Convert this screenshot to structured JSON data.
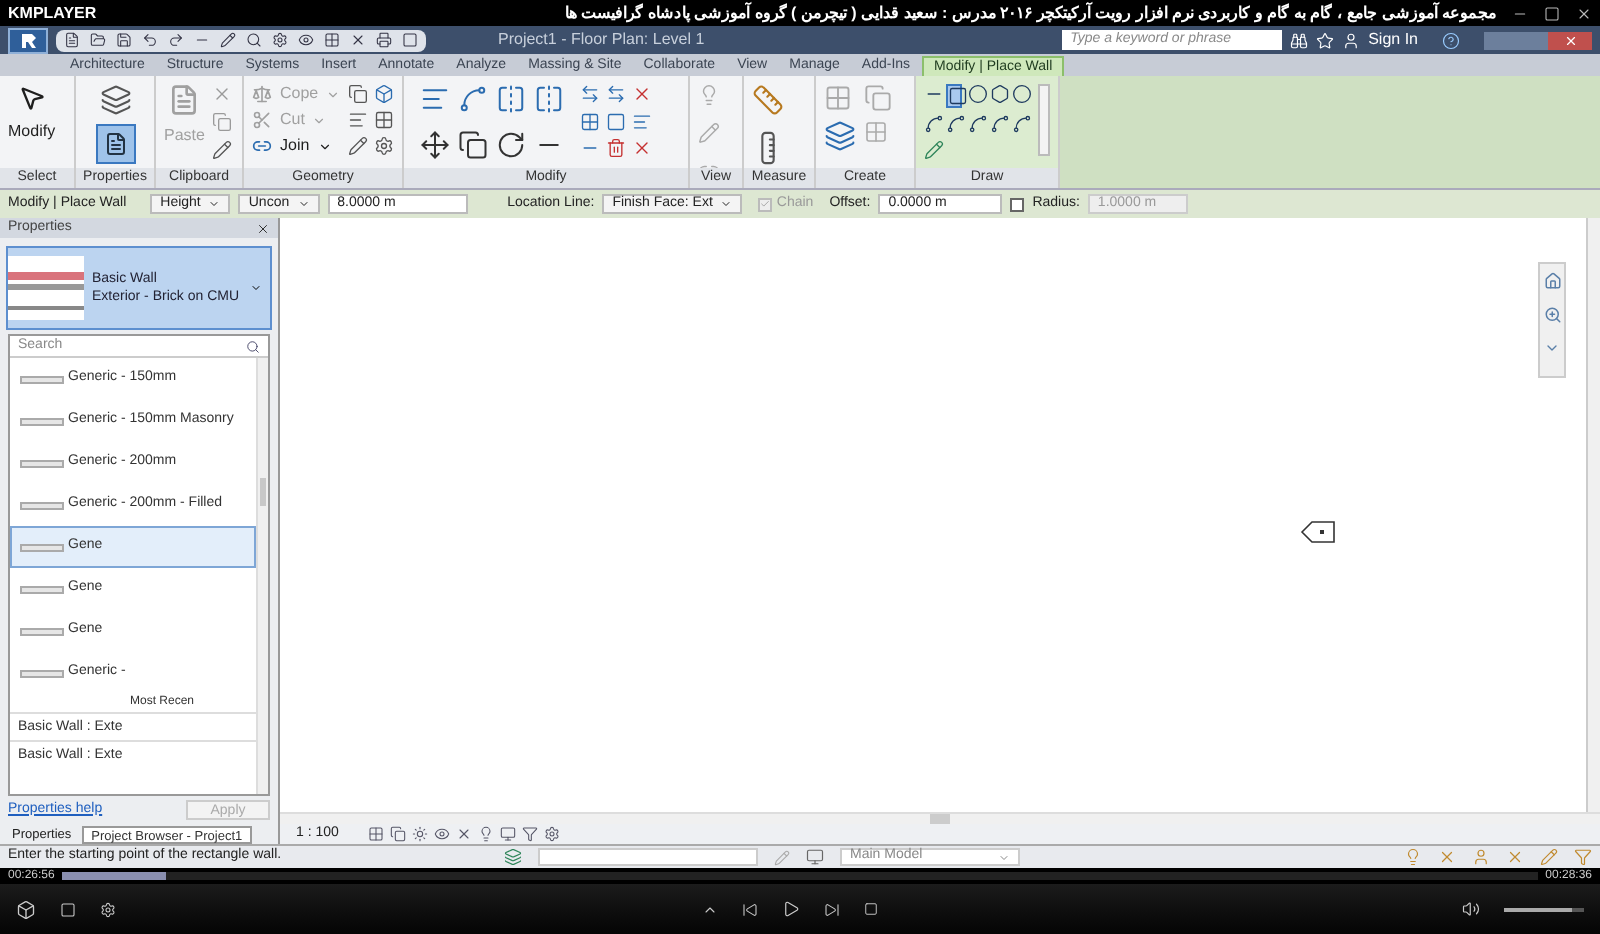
{
  "player": {
    "brand": "KMPLAYER",
    "title": "مجموعه آموزشی جامع ، گام به گام و کاربردی نرم افزار رویت آرکیتکچر ۲۰۱۶  مدرس : سعید قدایی ( تیچرمن ) گروه آموزشی پادشاه گرافیست ها"
  },
  "app": {
    "document_title": "Project1 - Floor Plan: Level 1",
    "search": {
      "placeholder": "Type a keyword or phrase"
    },
    "sign_in": "Sign In"
  },
  "ribbon_tabs": [
    {
      "label": "Architecture",
      "selected": false
    },
    {
      "label": "Structure",
      "selected": false
    },
    {
      "label": "Systems",
      "selected": false
    },
    {
      "label": "Insert",
      "selected": false
    },
    {
      "label": "Annotate",
      "selected": false
    },
    {
      "label": "Analyze",
      "selected": false
    },
    {
      "label": "Massing & Site",
      "selected": false
    },
    {
      "label": "Collaborate",
      "selected": false
    },
    {
      "label": "View",
      "selected": false
    },
    {
      "label": "Manage",
      "selected": false
    },
    {
      "label": "Add-Ins",
      "selected": false
    },
    {
      "label": "Modify | Place Wall",
      "selected": true
    }
  ],
  "ribbon_panels": [
    {
      "kind": "select",
      "title": "Select",
      "tools": [
        {
          "label": "Modify",
          "disabled": false
        }
      ]
    },
    {
      "kind": "properties",
      "title": "Properties"
    },
    {
      "kind": "clipboard",
      "title": "Clipboard",
      "tools": [
        {
          "label": "Paste",
          "disabled": true
        }
      ]
    },
    {
      "kind": "geometry",
      "title": "Geometry",
      "tools": [
        {
          "label": "Cope",
          "disabled": true
        },
        {
          "label": "Cut",
          "disabled": true
        },
        {
          "label": "Join",
          "disabled": false
        }
      ]
    },
    {
      "kind": "modify",
      "title": "Modify"
    },
    {
      "kind": "view",
      "title": "View"
    },
    {
      "kind": "measure",
      "title": "Measure"
    },
    {
      "kind": "create",
      "title": "Create"
    },
    {
      "kind": "draw",
      "title": "Draw"
    }
  ],
  "options_bar": {
    "mode": "Modify | Place Wall",
    "height_mode": "Height",
    "constraint": "Uncon",
    "height_value": "8.0000 m",
    "location_label": "Location Line:",
    "location": "Finish Face: Ext",
    "chain": {
      "label": "Chain",
      "checked": true,
      "disabled": true
    },
    "offset_label": "Offset:",
    "offset": "0.0000 m",
    "radius": {
      "label": "Radius:",
      "checked": false
    },
    "radius_value": "1.0000 m"
  },
  "properties": {
    "title": "Properties",
    "type": {
      "family": "Basic Wall",
      "name": "Exterior - Brick on CMU"
    },
    "search": {
      "placeholder": "Search"
    },
    "items": [
      {
        "label": "Generic - 150mm",
        "selected": false
      },
      {
        "label": "Generic - 150mm Masonry",
        "selected": false
      },
      {
        "label": "Generic - 200mm",
        "selected": false
      },
      {
        "label": "Generic - 200mm - Filled",
        "selected": false
      },
      {
        "label": "Gene",
        "selected": true
      },
      {
        "label": "Gene",
        "selected": false
      },
      {
        "label": "Gene",
        "selected": false
      },
      {
        "label": "Generic -",
        "selected": false
      }
    ],
    "recent_heading": "Most Recen",
    "recent": [
      "Basic Wall : Exte",
      "Basic Wall : Exte"
    ],
    "help": "Properties help",
    "apply": "Apply",
    "tabs": [
      {
        "label": "Properties",
        "selected": true
      },
      {
        "label": "Project Browser - Project1",
        "selected": false
      }
    ]
  },
  "view_bar": {
    "scale": "1 : 100"
  },
  "status_bar": {
    "prompt": "Enter the starting point of the rectangle wall.",
    "workset": "Main Model"
  },
  "playback": {
    "elapsed": "00:26:56",
    "total": "00:28:36",
    "progress": {
      "level": 0.07
    },
    "volume": {
      "level": 0.85
    }
  }
}
